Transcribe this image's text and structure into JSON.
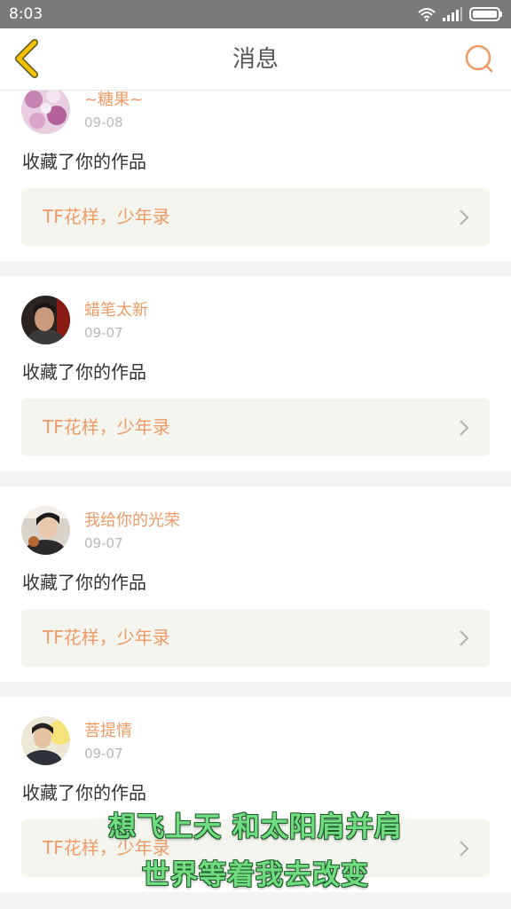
{
  "status_bar": {
    "time": "8:03",
    "icons": [
      "wifi-icon",
      "signal-icon",
      "battery-icon"
    ]
  },
  "header": {
    "title": "消息",
    "back_icon": "back-chevron-icon",
    "search_icon": "search-icon"
  },
  "colors": {
    "accent": "#ee9a66",
    "back_icon": "#f2c200",
    "status_bar": "#7a7a7a",
    "subtitle_text": "#6fdc80"
  },
  "messages": [
    {
      "username": "~糖果~",
      "date": "09-08",
      "action": "收藏了你的作品",
      "work_title": "TF花样，少年录"
    },
    {
      "username": "蜡笔太新",
      "date": "09-07",
      "action": "收藏了你的作品",
      "work_title": "TF花样，少年录"
    },
    {
      "username": "我给你的光荣",
      "date": "09-07",
      "action": "收藏了你的作品",
      "work_title": "TF花样，少年录"
    },
    {
      "username": "菩提情",
      "date": "09-07",
      "action": "收藏了你的作品",
      "work_title": "TF花样，少年录"
    }
  ],
  "subtitles": [
    "想飞上天 和太阳肩并肩",
    "世界等着我去改变"
  ]
}
